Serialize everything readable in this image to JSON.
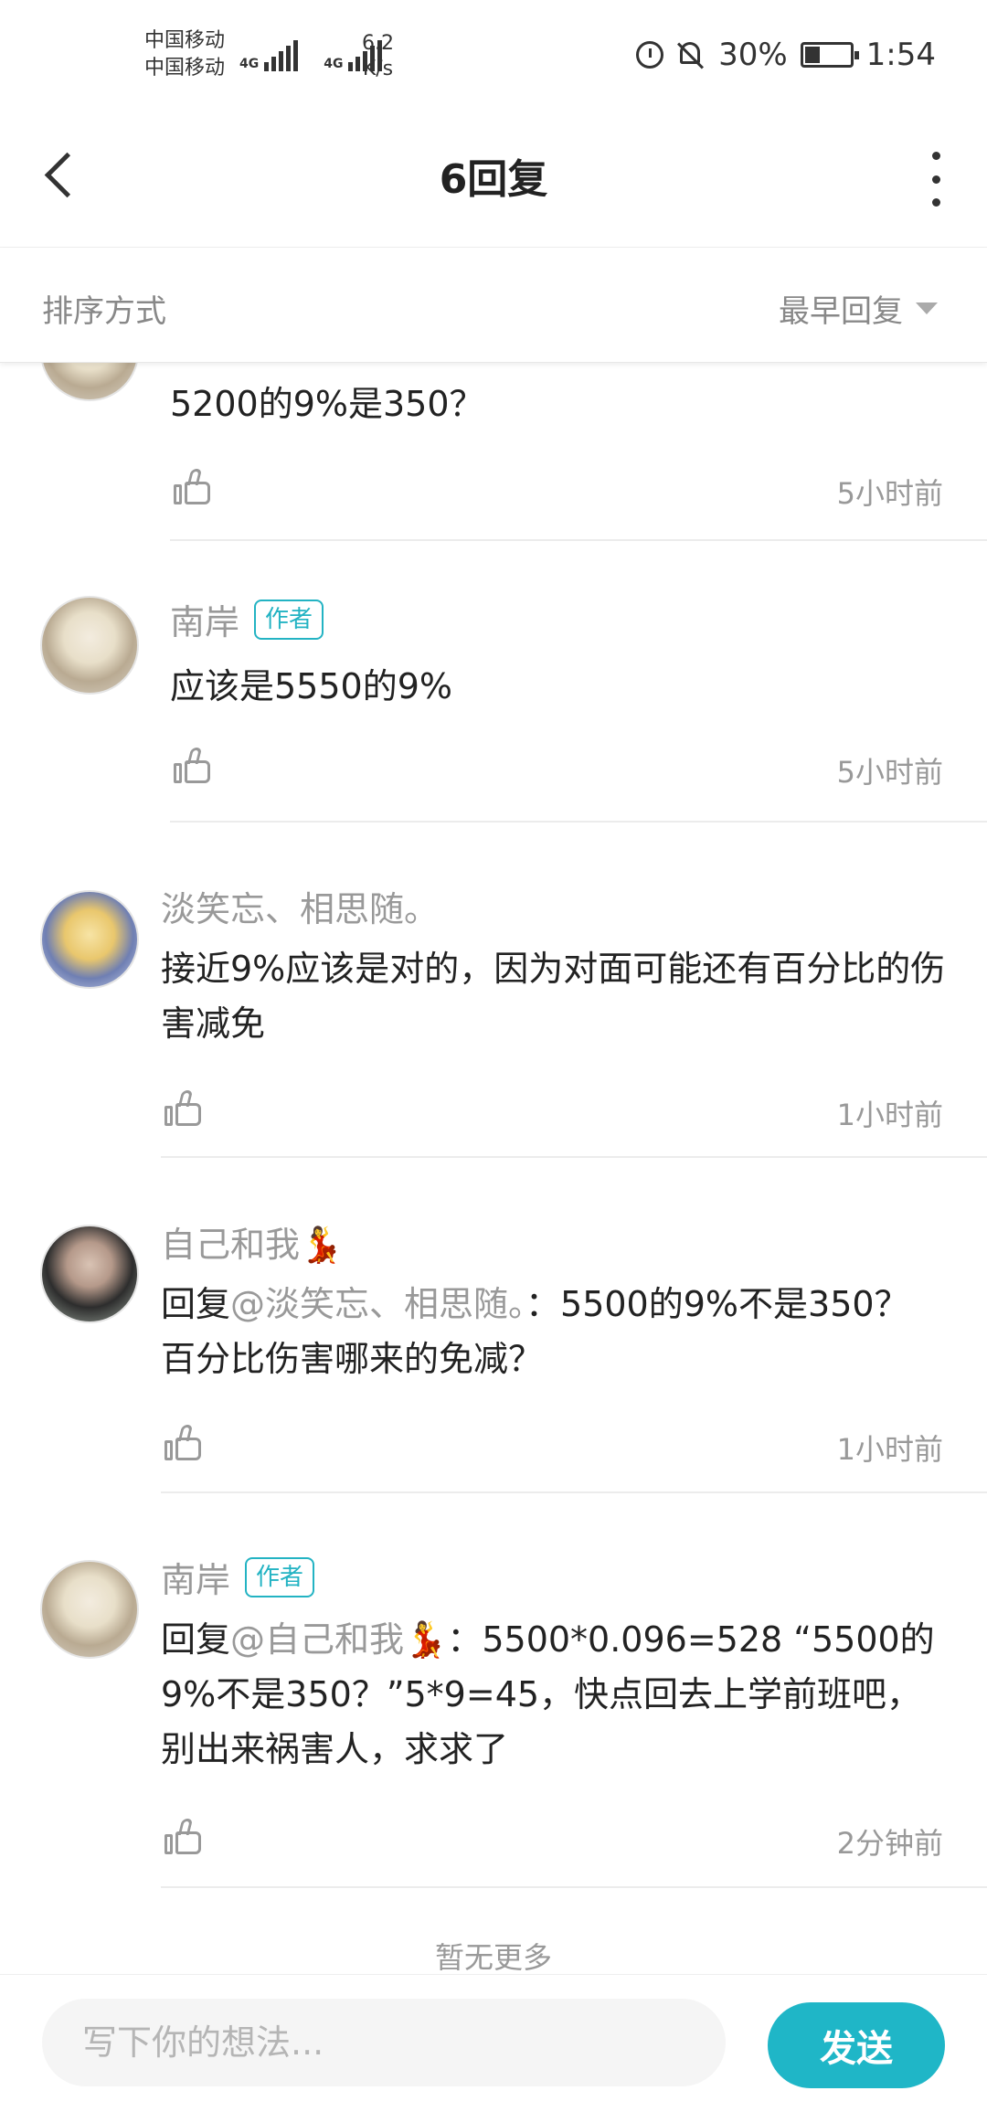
{
  "status_bar": {
    "carrier1": "中国移动",
    "carrier2": "中国移动",
    "net1": "4G",
    "net2": "4G",
    "speed_value": "6.2",
    "speed_unit": "K/s",
    "battery": "30%",
    "time": "1:54"
  },
  "header": {
    "title": "6回复"
  },
  "sort": {
    "label": "排序方式",
    "value": "最早回复"
  },
  "comments": [
    {
      "text": "5200的9%是350？",
      "time": "5小时前"
    },
    {
      "author": "南岸",
      "badge": "作者",
      "text": "应该是5550的9%",
      "time": "5小时前"
    },
    {
      "author": "淡笑忘、相思随。",
      "text": "接近9%应该是对的，因为对面可能还有百分比的伤害减免",
      "time": "1小时前"
    },
    {
      "author": "自己和我💃",
      "reply_prefix": "回复",
      "reply_to": "@淡笑忘、相思随。",
      "text": "：5500的9%不是350？百分比伤害哪来的免减？",
      "time": "1小时前"
    },
    {
      "author": "南岸",
      "badge": "作者",
      "reply_prefix": "回复",
      "reply_to": "@自己和我💃",
      "text": "：5500*0.096=528 “5500的9%不是350？”5*9=45，快点回去上学前班吧，别出来祸害人，求求了",
      "time": "2分钟前"
    }
  ],
  "footer_note": "暂无更多",
  "composer": {
    "placeholder": "写下你的想法...",
    "send_label": "发送"
  },
  "colors": {
    "accent": "#1fb6c7",
    "secondary_text": "#999999",
    "primary_text": "#222222"
  }
}
